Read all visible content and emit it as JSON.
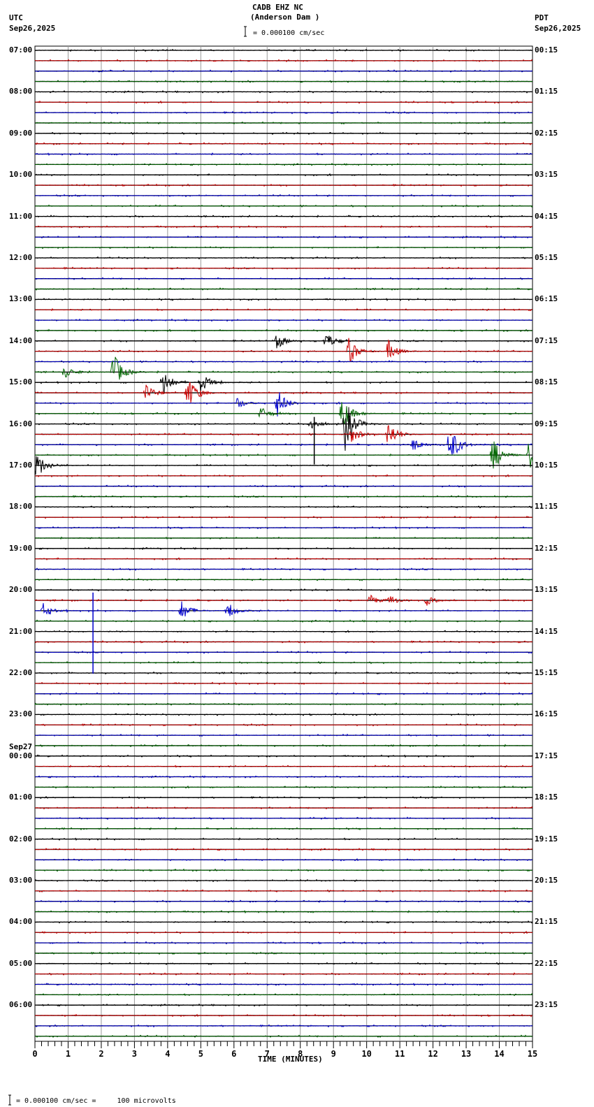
{
  "header": {
    "title": "CADB EHZ NC",
    "subtitle": "(Anderson Dam )",
    "scale": "= 0.000100 cm/sec",
    "left_tz": "UTC",
    "left_date": "Sep26,2025",
    "right_tz": "PDT",
    "right_date": "Sep26,2025"
  },
  "footer": {
    "scale_note": "= 0.000100 cm/sec =     100 microvolts"
  },
  "chart_data": {
    "type": "line",
    "title": "CADB EHZ NC (Anderson Dam )",
    "xlabel": "TIME (MINUTES)",
    "xlim": [
      0,
      15
    ],
    "x_ticks": [
      "0",
      "1",
      "2",
      "3",
      "4",
      "5",
      "6",
      "7",
      "8",
      "9",
      "10",
      "11",
      "12",
      "13",
      "14",
      "15"
    ],
    "traces_per_hour": 4,
    "trace_count": 96,
    "trace_colors": [
      "#000000",
      "#cc0000",
      "#0000cc",
      "#006600"
    ],
    "left_labels": [
      "07:00",
      "08:00",
      "09:00",
      "10:00",
      "11:00",
      "12:00",
      "13:00",
      "14:00",
      "15:00",
      "16:00",
      "17:00",
      "18:00",
      "19:00",
      "20:00",
      "21:00",
      "22:00",
      "23:00",
      "00:00",
      "01:00",
      "02:00",
      "03:00",
      "04:00",
      "05:00",
      "06:00"
    ],
    "date_change_label": "Sep27",
    "right_labels": [
      "00:15",
      "01:15",
      "02:15",
      "03:15",
      "04:15",
      "05:15",
      "06:15",
      "07:15",
      "08:15",
      "09:15",
      "10:15",
      "11:15",
      "12:15",
      "13:15",
      "14:15",
      "15:15",
      "16:15",
      "17:15",
      "18:15",
      "19:15",
      "20:15",
      "21:15",
      "22:15",
      "23:15"
    ],
    "events": [
      {
        "trace": 28,
        "minute": 7.3,
        "amp": 12
      },
      {
        "trace": 28,
        "minute": 8.75,
        "amp": 14
      },
      {
        "trace": 29,
        "minute": 9.45,
        "amp": 20
      },
      {
        "trace": 29,
        "minute": 10.65,
        "amp": 16
      },
      {
        "trace": 31,
        "minute": 0.9,
        "amp": 10
      },
      {
        "trace": 31,
        "minute": 2.35,
        "amp": 30
      },
      {
        "trace": 32,
        "minute": 3.85,
        "amp": 20
      },
      {
        "trace": 32,
        "minute": 5.0,
        "amp": 16
      },
      {
        "trace": 33,
        "minute": 3.35,
        "amp": 12
      },
      {
        "trace": 33,
        "minute": 4.6,
        "amp": 25
      },
      {
        "trace": 34,
        "minute": 6.1,
        "amp": 8
      },
      {
        "trace": 34,
        "minute": 7.3,
        "amp": 22
      },
      {
        "trace": 35,
        "minute": 6.8,
        "amp": 10
      },
      {
        "trace": 35,
        "minute": 9.25,
        "amp": 25
      },
      {
        "trace": 36,
        "minute": 8.3,
        "amp": 10
      },
      {
        "trace": 36,
        "minute": 9.35,
        "amp": 40
      },
      {
        "trace": 37,
        "minute": 9.55,
        "amp": 12
      },
      {
        "trace": 37,
        "minute": 10.65,
        "amp": 20
      },
      {
        "trace": 38,
        "minute": 11.4,
        "amp": 10
      },
      {
        "trace": 38,
        "minute": 12.5,
        "amp": 30
      },
      {
        "trace": 39,
        "minute": 13.8,
        "amp": 25
      },
      {
        "trace": 39,
        "minute": 14.9,
        "amp": 25
      },
      {
        "trace": 40,
        "minute": 0.05,
        "amp": 20
      },
      {
        "trace": 53,
        "minute": 10.1,
        "amp": 8
      },
      {
        "trace": 53,
        "minute": 10.7,
        "amp": 7
      },
      {
        "trace": 53,
        "minute": 11.8,
        "amp": 7
      },
      {
        "trace": 54,
        "minute": 0.25,
        "amp": 10
      },
      {
        "trace": 54,
        "minute": 4.4,
        "amp": 15
      },
      {
        "trace": 54,
        "minute": 5.8,
        "amp": 12
      }
    ],
    "spikes": [
      {
        "trace": 36,
        "minute": 8.42,
        "down": 58
      },
      {
        "trace": 54,
        "minute": 1.75,
        "down": 90,
        "up": 26
      }
    ]
  }
}
